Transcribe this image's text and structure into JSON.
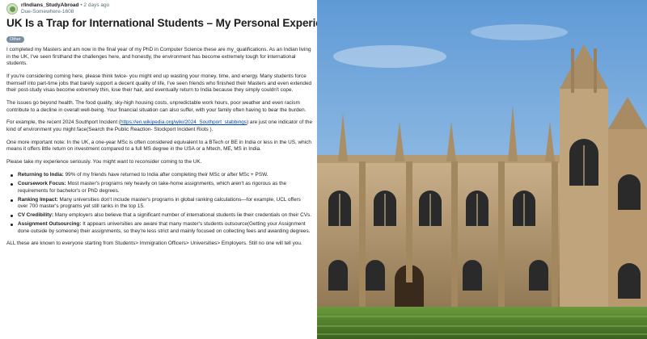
{
  "post": {
    "subreddit": "r/Indians_StudyAbroad",
    "separator": "•",
    "time": "2 days ago",
    "username": "Due-Somewhere-1608",
    "title": "UK Is a Trap for International Students – My Personal Experience",
    "flair": "Other",
    "paragraphs": [
      "I completed my Masters and am now in the final year of my PhD in Computer Science these are my_qualifications. As an Indian living in the UK, I've seen firsthand the challenges here, and honestly, the environment has become extremely tough for international students.",
      "If you're considering coming here, please think twice- you might end up wasting your money, time, and energy. Many students force themself into part-time jobs that barely support a decent quality of life, I've seen friends who finished their Masters and even extended their post-study visas become extremely thin, lose their hair, and eventually return to India because they simply couldn't cope.",
      "The issues go beyond health. The food quality, sky-high housing costs, unpredictable work hours, poor weather and even racism contribute to a decline in overall well-being. Your financial situation can also suffer, with your family often having to bear the burden."
    ],
    "example_pre": "For example, the recent 2024 Southport Incident (",
    "example_link": "https://en.wikipedia.org/wiki/2024_Southport_stabbings",
    "example_post": ") are just one indicator of the kind of environment you might face(Search the Public Reaction- Stockport Incident Riots ).",
    "paragraph_msc": "One more important note: In the UK, a one-year MSc is often considered equivalent to a BTech or BE in India or less in the US, which means it offers little return on investment compared to a full MS degree in the USA or a Mtech, ME, MS in India.",
    "paragraph_serious": "Please take my experience seriously. You might want to reconsider coming to the UK.",
    "bullets": [
      {
        "label": "Returning to India:",
        "text": " 99% of my friends have returned to India after completing their MSc or after MSc + PSW."
      },
      {
        "label": "Coursework Focus:",
        "text": " Most master's programs rely heavily on take-home assignments, which aren't as rigorous as the requirements for bachelor's or PhD degrees."
      },
      {
        "label": "Ranking Impact:",
        "text": " Many universities don't include master's programs in global ranking calculations—for example, UCL offers over 700 master's programs yet still ranks in the top 15."
      },
      {
        "label": "CV Credibility:",
        "text": " Many employers also believe that a significant number of international students lie their credentials on their CVs."
      },
      {
        "label": "Assignment Outsourcing:",
        "text": " It appears universities are aware that many master's students outsource(Getting your Assignment done outside by someone) their assignments, so they're less strict and mainly focused on collecting fees and awarding degrees."
      }
    ],
    "closing": "ALL these are known to everyone starting from Students> Immigration Officers> Universities> Employers. Still no one will tell you."
  },
  "colors": {
    "link": "#0045ac",
    "flair_bg": "#7a8ea3",
    "sky": "#7fb2e2",
    "stone": "#b39a72",
    "lawn": "#4f7a2c"
  }
}
